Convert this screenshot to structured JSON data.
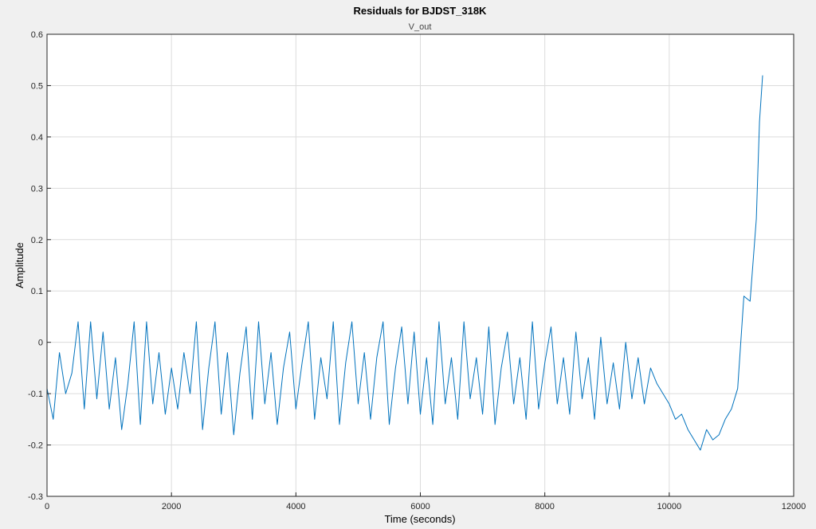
{
  "colors": {
    "figure_background": "#f0f0f0",
    "axes_background": "#ffffff",
    "grid": "#dcdcdc",
    "axis": "#262626",
    "series": "#0072bd"
  },
  "chart_data": {
    "type": "line",
    "title": "Residuals for BJDST_318K",
    "subtitle": "V_out",
    "xlabel": "Time (seconds)",
    "ylabel": "Amplitude",
    "xlim": [
      0,
      12000
    ],
    "ylim": [
      -0.3,
      0.6
    ],
    "xticks": [
      0,
      2000,
      4000,
      6000,
      8000,
      10000,
      12000
    ],
    "xtick_labels": [
      "0",
      "2000",
      "4000",
      "6000",
      "8000",
      "10000",
      "12000"
    ],
    "yticks": [
      -0.3,
      -0.2,
      -0.1,
      0,
      0.1,
      0.2,
      0.3,
      0.4,
      0.5,
      0.6
    ],
    "ytick_labels": [
      "-0.3",
      "-0.2",
      "-0.1",
      "0",
      "0.1",
      "0.2",
      "0.3",
      "0.4",
      "0.5",
      "0.6"
    ],
    "grid": true,
    "series": [
      {
        "values_x": [
          0,
          100,
          200,
          300,
          400,
          500,
          600,
          700,
          800,
          900,
          1000,
          1100,
          1200,
          1300,
          1400,
          1500,
          1600,
          1700,
          1800,
          1900,
          2000,
          2100,
          2200,
          2300,
          2400,
          2500,
          2600,
          2700,
          2800,
          2900,
          3000,
          3100,
          3200,
          3300,
          3400,
          3500,
          3600,
          3700,
          3800,
          3900,
          4000,
          4100,
          4200,
          4300,
          4400,
          4500,
          4600,
          4700,
          4800,
          4900,
          5000,
          5100,
          5200,
          5300,
          5400,
          5500,
          5600,
          5700,
          5800,
          5900,
          6000,
          6100,
          6200,
          6300,
          6400,
          6500,
          6600,
          6700,
          6800,
          6900,
          7000,
          7100,
          7200,
          7300,
          7400,
          7500,
          7600,
          7700,
          7800,
          7900,
          8000,
          8100,
          8200,
          8300,
          8400,
          8500,
          8600,
          8700,
          8800,
          8900,
          9000,
          9100,
          9200,
          9300,
          9400,
          9500,
          9600,
          9700,
          9800,
          9900,
          10000,
          10100,
          10200,
          10300,
          10400,
          10500,
          10600,
          10700,
          10800,
          10900,
          11000,
          11100,
          11200,
          11300,
          11400,
          11450,
          11500
        ],
        "values_y": [
          -0.09,
          -0.15,
          -0.02,
          -0.1,
          -0.06,
          0.04,
          -0.13,
          0.04,
          -0.11,
          0.02,
          -0.13,
          -0.03,
          -0.17,
          -0.08,
          0.04,
          -0.16,
          0.04,
          -0.12,
          -0.02,
          -0.14,
          -0.05,
          -0.13,
          -0.02,
          -0.1,
          0.04,
          -0.17,
          -0.05,
          0.04,
          -0.14,
          -0.02,
          -0.18,
          -0.06,
          0.03,
          -0.15,
          0.04,
          -0.12,
          -0.02,
          -0.16,
          -0.05,
          0.02,
          -0.13,
          -0.04,
          0.04,
          -0.15,
          -0.03,
          -0.11,
          0.04,
          -0.16,
          -0.04,
          0.04,
          -0.12,
          -0.02,
          -0.15,
          -0.03,
          0.04,
          -0.16,
          -0.05,
          0.03,
          -0.12,
          0.02,
          -0.14,
          -0.03,
          -0.16,
          0.04,
          -0.12,
          -0.03,
          -0.15,
          0.04,
          -0.11,
          -0.03,
          -0.14,
          0.03,
          -0.16,
          -0.05,
          0.02,
          -0.12,
          -0.03,
          -0.15,
          0.04,
          -0.13,
          -0.04,
          0.03,
          -0.12,
          -0.03,
          -0.14,
          0.02,
          -0.11,
          -0.03,
          -0.15,
          0.01,
          -0.12,
          -0.04,
          -0.13,
          0.0,
          -0.11,
          -0.03,
          -0.12,
          -0.05,
          -0.08,
          -0.1,
          -0.12,
          -0.15,
          -0.14,
          -0.17,
          -0.19,
          -0.21,
          -0.17,
          -0.19,
          -0.18,
          -0.15,
          -0.13,
          -0.09,
          0.09,
          0.08,
          0.24,
          0.43,
          0.52
        ]
      }
    ]
  }
}
